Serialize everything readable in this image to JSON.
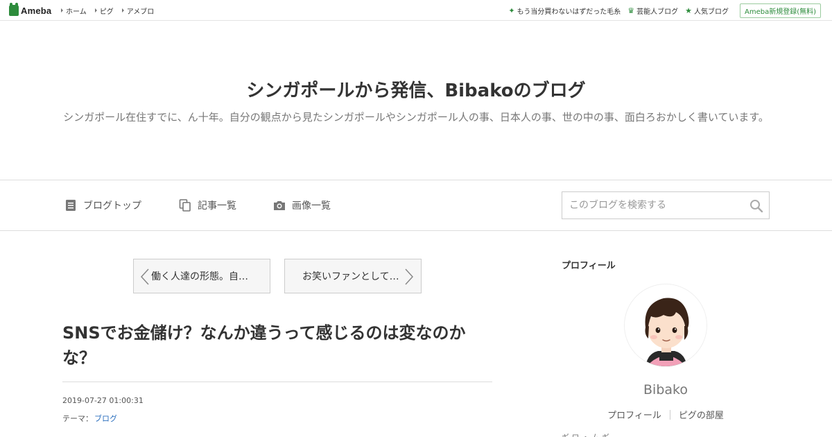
{
  "topbar": {
    "logo": "Ameba",
    "nav": [
      "ホーム",
      "ピグ",
      "アメブロ"
    ],
    "right_links": [
      {
        "label": "もう当分買わないはずだった毛糸",
        "icon": "sparkle-icon"
      },
      {
        "label": "芸能人ブログ",
        "icon": "crown-icon"
      },
      {
        "label": "人気ブログ",
        "icon": "star-icon"
      }
    ],
    "register": "Ameba新規登録(無料)"
  },
  "header": {
    "title": "シンガポールから発信、Bibakoのブログ",
    "description": "シンガポール在住すでに、ん十年。自分の観点から見たシンガポールやシンガポール人の事、日本人の事、世の中の事、面白ろおかしく書いています。"
  },
  "nav": {
    "items": [
      {
        "label": "ブログトップ",
        "icon": "document-icon"
      },
      {
        "label": "記事一覧",
        "icon": "copy-icon"
      },
      {
        "label": "画像一覧",
        "icon": "camera-icon"
      }
    ],
    "search_placeholder": "このブログを検索する"
  },
  "pager": {
    "prev": "働く人達の形態。自…",
    "next": "お笑いファンとして…"
  },
  "article": {
    "title": "SNSでお金儲け？なんか違うって感じるのは変なのかな？",
    "date": "2019-07-27 01:00:31",
    "theme_label": "テーマ：",
    "theme": "ブログ"
  },
  "sidebar": {
    "heading": "プロフィール",
    "name": "Bibako",
    "links": [
      "プロフィール",
      "ピグの部屋"
    ],
    "more": "ギ ロ ・ ム ギ"
  },
  "colors": {
    "brand_green": "#2d8c3c",
    "link_blue": "#2a6ebd"
  }
}
